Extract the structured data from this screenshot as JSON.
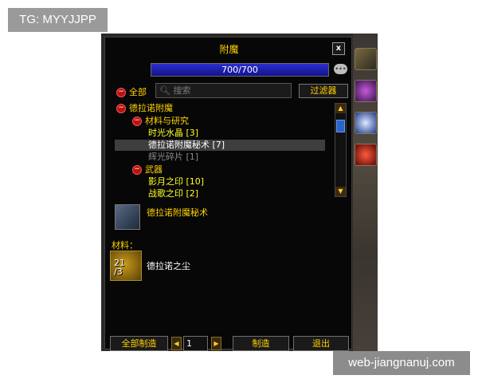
{
  "watermarks": {
    "top": "TG: MYYJJPP",
    "bottom": "web-jiangnanuj.com"
  },
  "window": {
    "title": "附魔",
    "close_label": "x"
  },
  "skill": {
    "value": "700/700",
    "progress": 1.0
  },
  "filter": {
    "all_label": "全部",
    "search_placeholder": "搜索",
    "filter_button": "过滤器"
  },
  "tree": {
    "category": "德拉诺附魔",
    "groups": [
      {
        "name": "材料与研究",
        "items": [
          "时光水晶 [3]",
          "德拉诺附魔秘术 [7]",
          "辉光碎片 [1]"
        ]
      },
      {
        "name": "武器",
        "items": [
          "影月之印 [10]",
          "战歌之印 [2]"
        ]
      }
    ]
  },
  "selected_recipe": {
    "name": "德拉诺附魔秘术"
  },
  "materials": {
    "label": "材料：",
    "items": [
      {
        "count": "21",
        "required": "/3",
        "name": "德拉诺之尘"
      }
    ]
  },
  "bottom": {
    "craft_all": "全部制造",
    "quantity": "1",
    "craft": "制造",
    "exit": "退出"
  },
  "colors": {
    "header_gold": "#ffd200",
    "recipe_yellow": "#ffff22",
    "disabled_gray": "#8a8a8a",
    "skill_bar_blue": "#2b2ecf"
  }
}
